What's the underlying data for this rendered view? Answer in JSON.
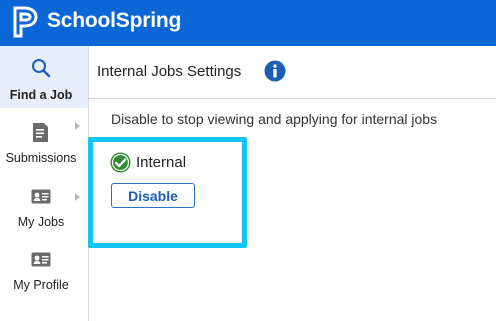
{
  "app": {
    "name": "SchoolSpring",
    "logo_icon": "schoolspring-logo-icon",
    "brand_color": "#0b66d6"
  },
  "sidebar": {
    "items": [
      {
        "label": "Find a Job",
        "icon": "search-icon",
        "active": true,
        "has_submenu": false
      },
      {
        "label": "Submissions",
        "icon": "document-icon",
        "active": false,
        "has_submenu": true
      },
      {
        "label": "My Jobs",
        "icon": "id-card-icon",
        "active": false,
        "has_submenu": true
      },
      {
        "label": "My Profile",
        "icon": "id-card-icon",
        "active": false,
        "has_submenu": false
      }
    ]
  },
  "main": {
    "title": "Internal Jobs Settings",
    "info_icon": "info-icon",
    "description": "Disable to stop viewing and applying for internal jobs",
    "status": {
      "label": "Internal",
      "icon": "check-circle-icon",
      "color": "#2e8b2e"
    },
    "disable_button_label": "Disable",
    "highlight_color": "#12c6f1"
  }
}
